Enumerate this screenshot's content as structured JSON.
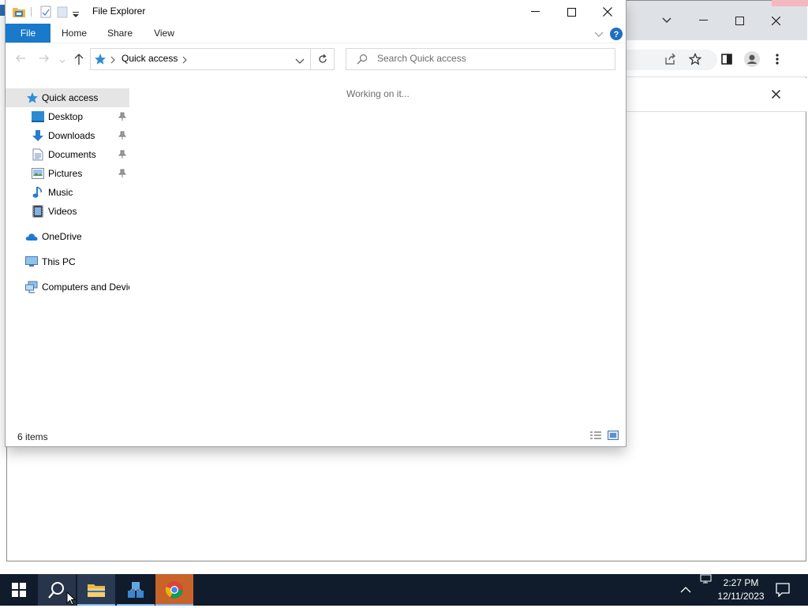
{
  "explorer": {
    "title": "File Explorer",
    "ribbon_tabs": [
      "File",
      "Home",
      "Share",
      "View"
    ],
    "address": {
      "crumb": "Quick access"
    },
    "search_placeholder": "Search Quick access",
    "working_text": "Working on it...",
    "status_text": "6 items",
    "nav": {
      "quick_access": "Quick access",
      "pinned": [
        {
          "label": "Desktop",
          "icon": "desktop-icon",
          "pinned": true
        },
        {
          "label": "Downloads",
          "icon": "downloads-icon",
          "pinned": true
        },
        {
          "label": "Documents",
          "icon": "documents-icon",
          "pinned": true
        },
        {
          "label": "Pictures",
          "icon": "pictures-icon",
          "pinned": true
        },
        {
          "label": "Music",
          "icon": "music-icon",
          "pinned": false
        },
        {
          "label": "Videos",
          "icon": "videos-icon",
          "pinned": false
        }
      ],
      "onedrive": "OneDrive",
      "this_pc": "This PC",
      "network": "Computers and Devic"
    }
  },
  "taskbar": {
    "time": "2:27 PM",
    "date": "12/11/2023",
    "icons": [
      "windows-start-icon",
      "search-icon",
      "file-explorer-icon",
      "network-app-icon",
      "chrome-icon"
    ]
  },
  "colors": {
    "file_tab": "#1979ca",
    "taskbar": "#101c2c",
    "chrome_titlebar": "#dee1e6",
    "selected_nav": "#e5e5e5"
  }
}
